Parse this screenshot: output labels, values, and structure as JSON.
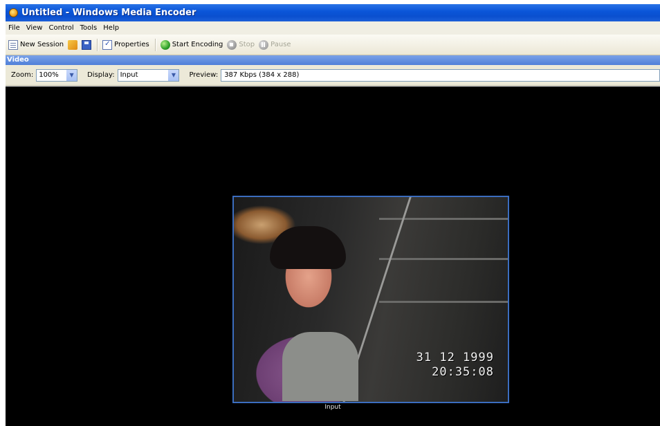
{
  "window": {
    "title": "Untitled - Windows Media Encoder"
  },
  "menu": [
    "File",
    "View",
    "Control",
    "Tools",
    "Help"
  ],
  "toolbar": {
    "new_session": "New Session",
    "properties": "Properties",
    "start_encoding": "Start Encoding",
    "stop": "Stop",
    "pause": "Pause"
  },
  "video_panel": {
    "header": "Video",
    "zoom_label": "Zoom:",
    "zoom_value": "100%",
    "display_label": "Display:",
    "display_value": "Input",
    "preview_label": "Preview:",
    "preview_value": "387 Kbps (384 x 288)"
  },
  "video": {
    "osd_date": "31 12 1999",
    "osd_time": "20:35:08",
    "caption": "Input"
  },
  "colors": {
    "title_bar": "#0b56d9",
    "frame_border": "#3b6dbf",
    "video_bg": "#000000"
  }
}
